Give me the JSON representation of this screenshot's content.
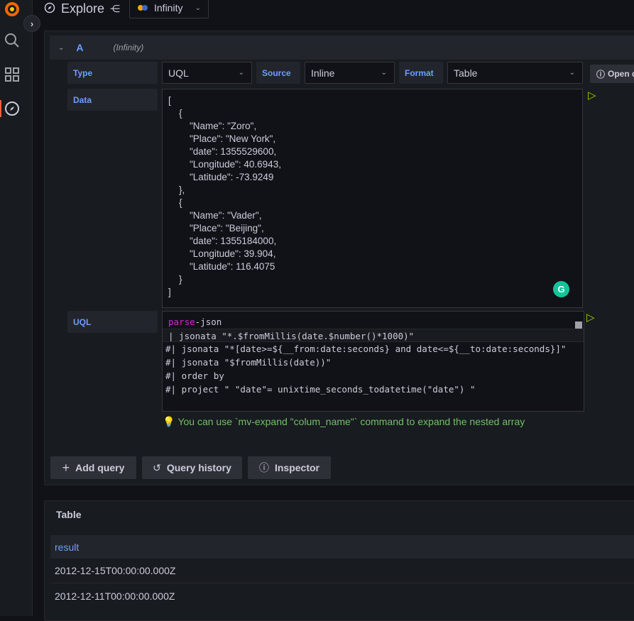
{
  "topbar": {
    "title": "Explore",
    "datasource": "Infinity"
  },
  "query": {
    "ref": "A",
    "datasource_hint": "(Infinity)",
    "type_label": "Type",
    "type_value": "UQL",
    "source_label": "Source",
    "source_value": "Inline",
    "format_label": "Format",
    "format_value": "Table",
    "open_button": "Open d",
    "data_label": "Data",
    "data_lines": [
      "[",
      "    {",
      "        \"Name\": \"Zoro\",",
      "        \"Place\": \"New York\",",
      "        \"date\": 1355529600,",
      "        \"Longitude\": 40.6943,",
      "        \"Latitude\": -73.9249",
      "    },",
      "    {",
      "        \"Name\": \"Vader\",",
      "        \"Place\": \"Beijing\",",
      "        \"date\": 1355184000,",
      "        \"Longitude\": 39.904,",
      "        \"Latitude\": 116.4075",
      "    }",
      "]"
    ],
    "uql_label": "UQL",
    "uql_line1_kw": "parse",
    "uql_line1_rest": "-json",
    "uql_lines": [
      "| jsonata \"*.$fromMillis(date.$number()*1000)\"",
      "#| jsonata \"*[date>=${__from:date:seconds} and date<=${__to:date:seconds}]\"",
      "#| jsonata \"$fromMillis(date))\"",
      "#| order by",
      "#| project \" \"date\"= unixtime_seconds_todatetime(\"date\") \""
    ],
    "hint": "You can use `mv-expand \"colum_name\"` command to expand the nested array"
  },
  "actions": {
    "add_query": "Add query",
    "query_history": "Query history",
    "inspector": "Inspector"
  },
  "table": {
    "title": "Table",
    "column": "result",
    "rows": [
      "2012-12-15T00:00:00.000Z",
      "2012-12-11T00:00:00.000Z"
    ]
  },
  "colors": {
    "accent": "#6e9fff",
    "run": "#a2d600",
    "hint": "#73bf69"
  }
}
